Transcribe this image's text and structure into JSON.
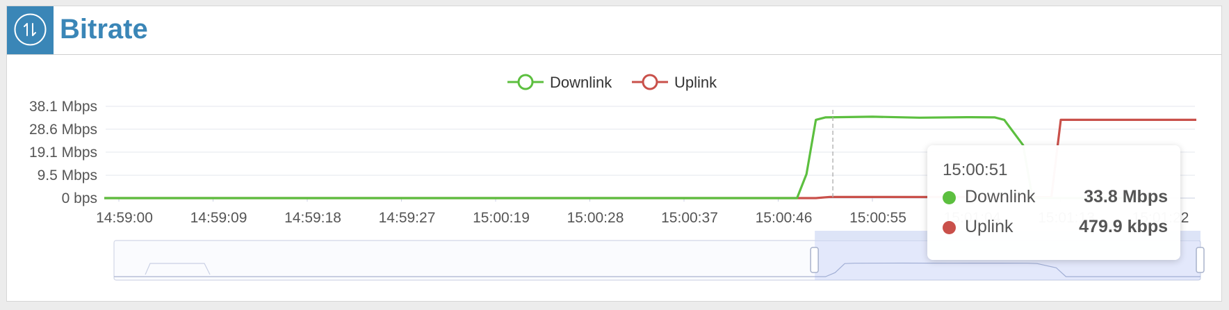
{
  "header": {
    "title": "Bitrate",
    "icon": "up-down-arrows-icon",
    "accent": "#3a86b7"
  },
  "legend": [
    {
      "name": "Downlink",
      "color": "#5cbf3f"
    },
    {
      "name": "Uplink",
      "color": "#c9504a"
    }
  ],
  "chart_data": {
    "type": "line",
    "y_tick_labels": [
      "0 bps",
      "9.5 Mbps",
      "19.1 Mbps",
      "28.6 Mbps",
      "38.1 Mbps"
    ],
    "y_tick_values": [
      0,
      9.5,
      19.1,
      28.6,
      38.1
    ],
    "ylim": [
      0,
      38.1
    ],
    "y_unit": "Mbps",
    "x_tick_labels": [
      "14:59:00",
      "14:59:09",
      "14:59:18",
      "14:59:27",
      "15:00:19",
      "15:00:28",
      "15:00:37",
      "15:00:46",
      "15:00:55",
      "15:01:04",
      "15:01:13",
      "15:01:22"
    ],
    "x_tick_values": [
      0,
      1,
      2,
      3,
      4,
      5,
      6,
      7,
      8,
      9,
      10,
      11
    ],
    "xlim": [
      -0.2,
      11.1
    ],
    "grid": true,
    "legend_position": "top",
    "series": [
      {
        "name": "Downlink",
        "color": "#5cbf3f",
        "x": [
          -0.2,
          7.2,
          7.3,
          7.4,
          7.5,
          8.0,
          8.5,
          9.0,
          9.3,
          9.4,
          9.6,
          9.7,
          11.1
        ],
        "y": [
          0,
          0,
          10,
          32.5,
          33.5,
          33.8,
          33.4,
          33.6,
          33.5,
          32.5,
          22,
          0,
          0
        ]
      },
      {
        "name": "Uplink",
        "color": "#c9504a",
        "x": [
          -0.2,
          7.4,
          7.55,
          9.9,
          10.0,
          11.45,
          11.6,
          11.85,
          12.0
        ],
        "y": [
          0,
          0,
          0.5,
          0.4,
          32.5,
          32.5,
          20,
          1.2,
          0.3
        ]
      }
    ],
    "hover_x": 7.58
  },
  "tooltip": {
    "time": "15:00:51",
    "rows": [
      {
        "name": "Downlink",
        "value": "33.8 Mbps",
        "color": "#5cbf3f"
      },
      {
        "name": "Uplink",
        "value": "479.9 kbps",
        "color": "#c9504a"
      }
    ]
  },
  "zoom": {
    "start_fraction": 0.645,
    "end_fraction": 1.0
  }
}
